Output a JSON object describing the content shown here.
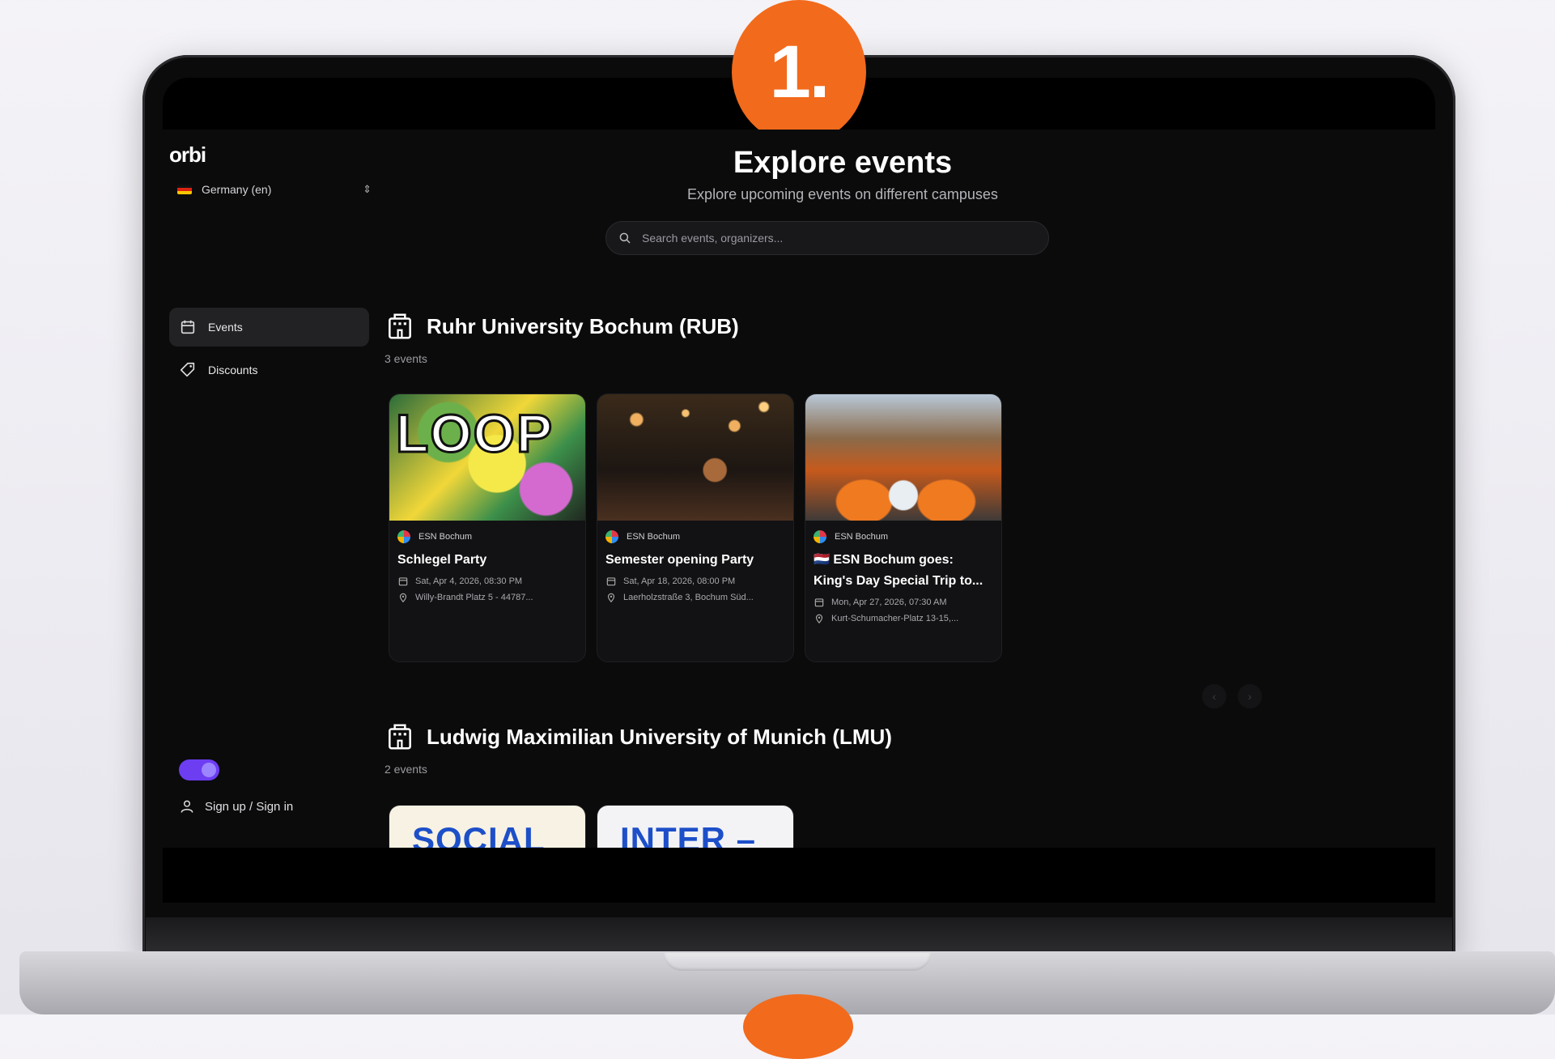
{
  "badge": {
    "number": "1."
  },
  "app": {
    "logo": "orbi",
    "region": {
      "label": "Germany (en)",
      "flag": "germany-flag"
    },
    "nav": [
      {
        "label": "Events",
        "icon": "calendar-icon",
        "active": true
      },
      {
        "label": "Discounts",
        "icon": "tag-icon",
        "active": false
      }
    ],
    "theme_toggle": {
      "on": true,
      "accent": "#6d3df2"
    },
    "signin_label": "Sign up / Sign in"
  },
  "main": {
    "title": "Explore events",
    "subtitle": "Explore upcoming events on different campuses",
    "search": {
      "placeholder": "Search events, organizers..."
    },
    "sections": [
      {
        "name": "Ruhr University Bochum (RUB)",
        "count": "3 events",
        "events": [
          {
            "image": "loop-poster",
            "image_text": "LOOP",
            "organizer": "ESN Bochum",
            "title": "Schlegel Party",
            "date": "Sat, Apr 4, 2026, 08:30 PM",
            "location": "Willy-Brandt Platz 5 - 44787..."
          },
          {
            "image": "party-crowd",
            "image_text": "",
            "organizer": "ESN Bochum",
            "title": "Semester opening Party",
            "date": "Sat, Apr 18, 2026, 08:00 PM",
            "location": "Laerholzstraße 3, Bochum Süd..."
          },
          {
            "image": "kings-day-canal",
            "image_text": "",
            "organizer": "ESN Bochum",
            "title": "🇳🇱 ESN Bochum goes: King's Day Special Trip to...",
            "date": "Mon, Apr 27, 2026, 07:30 AM",
            "location": "Kurt-Schumacher-Platz 13-15,..."
          }
        ]
      },
      {
        "name": "Ludwig Maximilian University of Munich (LMU)",
        "count": "2 events",
        "events": [
          {
            "image": "social-poster",
            "image_text": "SOCIAL"
          },
          {
            "image": "inter-poster",
            "image_text": "INTER –"
          }
        ]
      }
    ],
    "pager": {
      "prev": "‹",
      "next": "›"
    }
  },
  "colors": {
    "accent_orange": "#f26a1b",
    "background": "#0b0b0c"
  }
}
